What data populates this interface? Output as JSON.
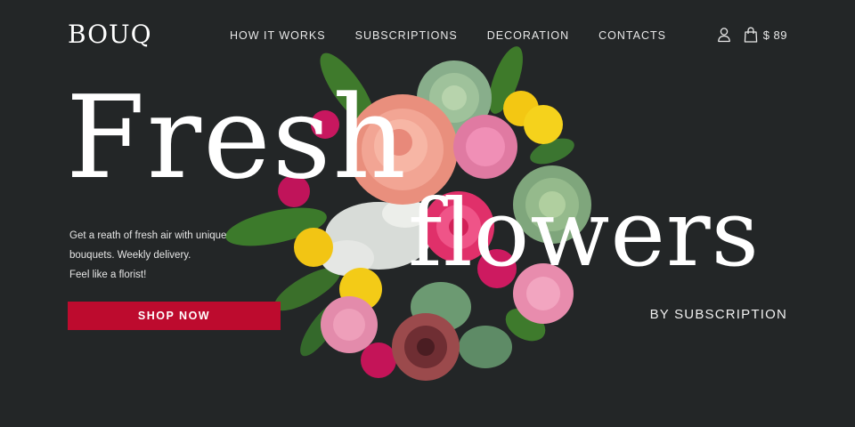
{
  "brand": {
    "logo": "BOUQ"
  },
  "nav": {
    "items": [
      {
        "label": "HOW IT WORKS"
      },
      {
        "label": "SUBSCRIPTIONS"
      },
      {
        "label": "DECORATION"
      },
      {
        "label": "CONTACTS"
      }
    ]
  },
  "header": {
    "cart_total": "$ 89",
    "icons": [
      "user-icon",
      "shopping-bag-icon"
    ]
  },
  "hero": {
    "headline_line1": "Fresh",
    "headline_line2": "flowers",
    "description_lines": [
      "Get a reath of fresh air with unique",
      "bouquets. Weekly delivery.",
      "Feel like a florist!"
    ],
    "cta_label": "SHOP NOW",
    "subtitle": "BY SUBSCRIPTION",
    "image_icon": "flower-bouquet-image"
  },
  "colors": {
    "background": "#232627",
    "accent": "#bd0b2e",
    "text": "#ffffff"
  }
}
